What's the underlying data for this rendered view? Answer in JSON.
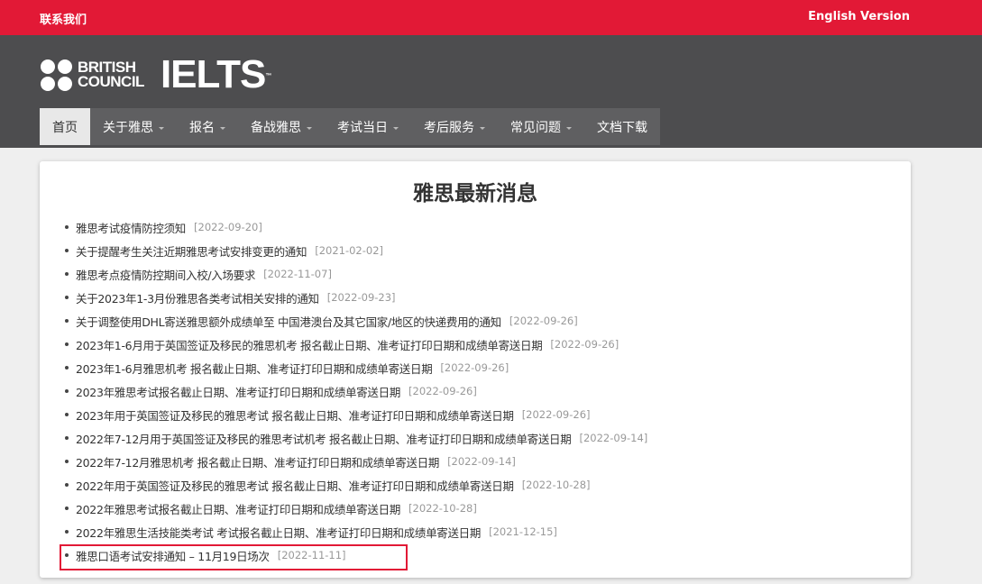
{
  "topbar": {
    "contact": "联系我们",
    "english": "English Version"
  },
  "logo": {
    "british": "BRITISH",
    "council": "COUNCIL",
    "ielts": "IELTS",
    "tm": "™"
  },
  "nav": [
    {
      "label": "首页",
      "active": true,
      "dropdown": false
    },
    {
      "label": "关于雅思",
      "active": false,
      "dropdown": true
    },
    {
      "label": "报名",
      "active": false,
      "dropdown": true
    },
    {
      "label": "备战雅思",
      "active": false,
      "dropdown": true
    },
    {
      "label": "考试当日",
      "active": false,
      "dropdown": true
    },
    {
      "label": "考后服务",
      "active": false,
      "dropdown": true
    },
    {
      "label": "常见问题",
      "active": false,
      "dropdown": true
    },
    {
      "label": "文档下载",
      "active": false,
      "dropdown": false
    }
  ],
  "main": {
    "title": "雅思最新消息",
    "news": [
      {
        "title": "雅思考试疫情防控须知",
        "date": "[2022-09-20]"
      },
      {
        "title": "关于提醒考生关注近期雅思考试安排变更的通知",
        "date": "[2021-02-02]"
      },
      {
        "title": "雅思考点疫情防控期间入校/入场要求",
        "date": "[2022-11-07]"
      },
      {
        "title": "关于2023年1-3月份雅思各类考试相关安排的通知",
        "date": "[2022-09-23]"
      },
      {
        "title": "关于调整使用DHL寄送雅思额外成绩单至 中国港澳台及其它国家/地区的快递费用的通知",
        "date": "[2022-09-26]"
      },
      {
        "title": "2023年1-6月用于英国签证及移民的雅思机考 报名截止日期、准考证打印日期和成绩单寄送日期",
        "date": "[2022-09-26]"
      },
      {
        "title": "2023年1-6月雅思机考 报名截止日期、准考证打印日期和成绩单寄送日期",
        "date": "[2022-09-26]"
      },
      {
        "title": "2023年雅思考试报名截止日期、准考证打印日期和成绩单寄送日期",
        "date": "[2022-09-26]"
      },
      {
        "title": "2023年用于英国签证及移民的雅思考试 报名截止日期、准考证打印日期和成绩单寄送日期",
        "date": "[2022-09-26]"
      },
      {
        "title": "2022年7-12月用于英国签证及移民的雅思考试机考 报名截止日期、准考证打印日期和成绩单寄送日期",
        "date": "[2022-09-14]"
      },
      {
        "title": "2022年7-12月雅思机考 报名截止日期、准考证打印日期和成绩单寄送日期",
        "date": "[2022-09-14]"
      },
      {
        "title": "2022年用于英国签证及移民的雅思考试 报名截止日期、准考证打印日期和成绩单寄送日期",
        "date": "[2022-10-28]"
      },
      {
        "title": "2022年雅思考试报名截止日期、准考证打印日期和成绩单寄送日期",
        "date": "[2022-10-28]"
      },
      {
        "title": "2022年雅思生活技能类考试 考试报名截止日期、准考证打印日期和成绩单寄送日期",
        "date": "[2021-12-15]"
      },
      {
        "title": "雅思口语考试安排通知 – 11月19日场次",
        "date": "[2022-11-11]"
      }
    ]
  },
  "colors": {
    "brand_red": "#e21936",
    "header_gray": "#4d4d4f",
    "nav_gray": "#5f5f61"
  }
}
